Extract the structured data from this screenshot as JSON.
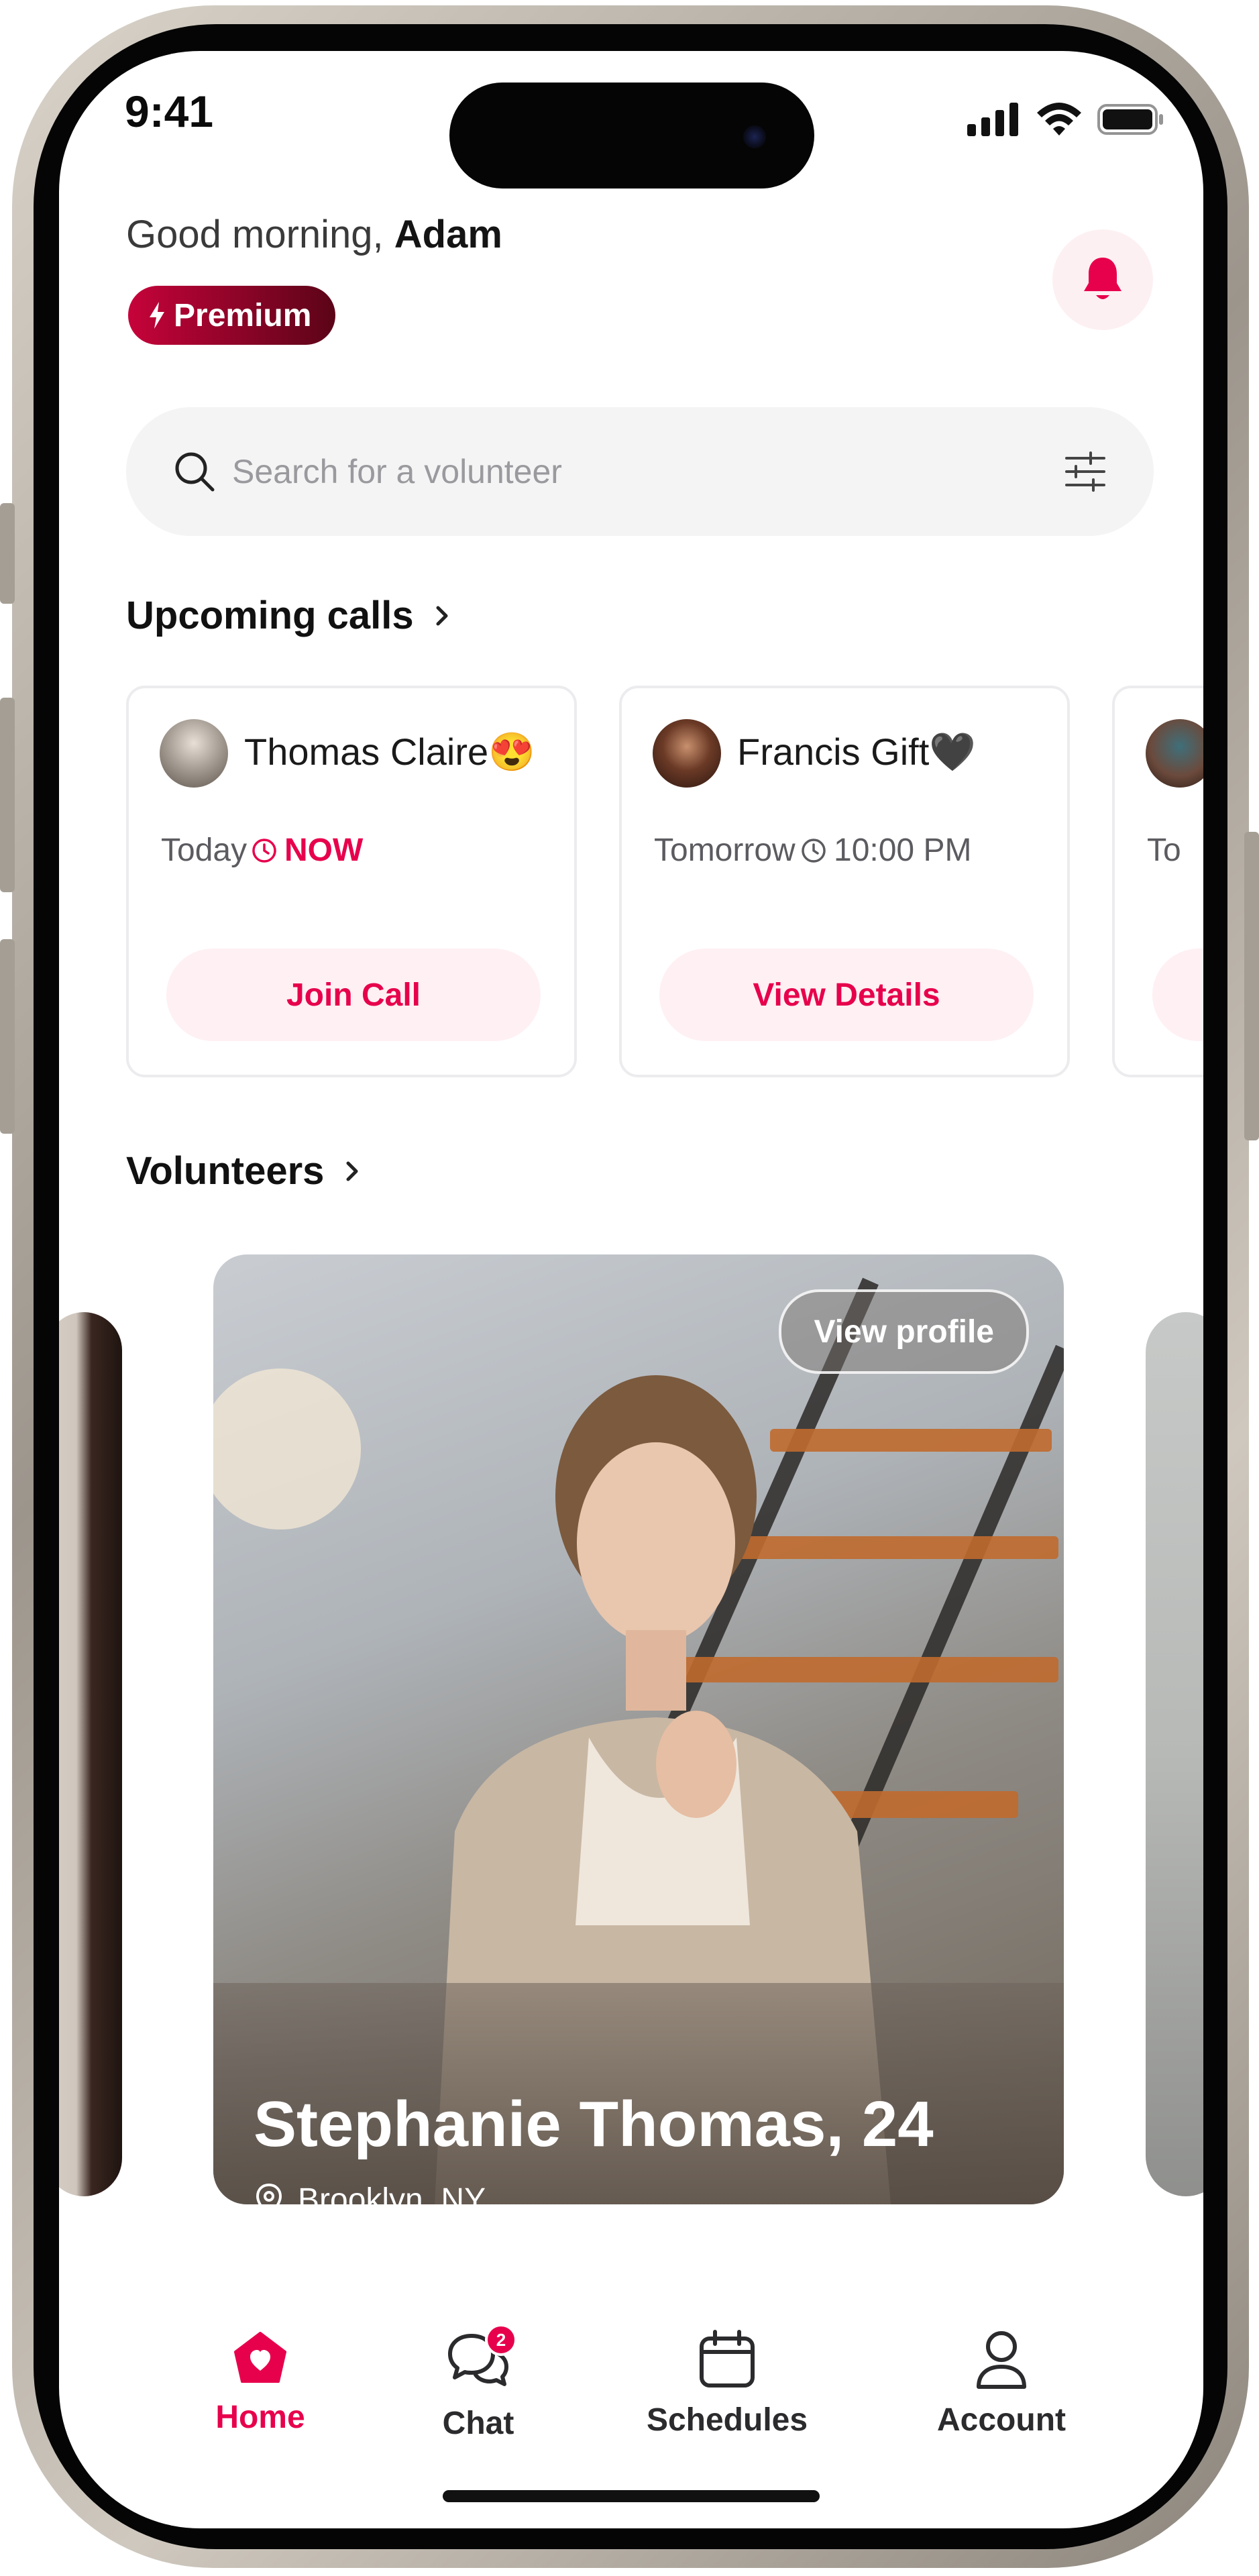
{
  "status_bar": {
    "time": "9:41"
  },
  "header": {
    "greeting_prefix": "Good morning,",
    "user_name": "Adam",
    "premium_label": "Premium"
  },
  "search": {
    "placeholder": "Search for a volunteer"
  },
  "upcoming": {
    "title": "Upcoming calls",
    "cards": [
      {
        "name": "Thomas Claire😍",
        "day": "Today",
        "time": "NOW",
        "action": "Join Call"
      },
      {
        "name": "Francis Gift🖤",
        "day": "Tomorrow",
        "time": "10:00 PM",
        "action": "View Details"
      },
      {
        "day": "To"
      }
    ]
  },
  "volunteers": {
    "title": "Volunteers",
    "featured": {
      "name": "Stephanie Thomas, 24",
      "location": "Brooklyn, NY",
      "view_profile": "View profile"
    }
  },
  "tab_bar": {
    "items": [
      {
        "label": "Home",
        "icon": "home-heart-icon",
        "active": true
      },
      {
        "label": "Chat",
        "icon": "chat-bubbles-icon",
        "badge": "2"
      },
      {
        "label": "Schedules",
        "icon": "calendar-icon"
      },
      {
        "label": "Account",
        "icon": "user-icon"
      }
    ]
  },
  "colors": {
    "accent": "#e7004c",
    "premium_gradient_start": "#c6033a",
    "premium_gradient_end": "#5b0418",
    "bell_background": "#fdf0f2",
    "call_action_background": "#fff0f3"
  }
}
